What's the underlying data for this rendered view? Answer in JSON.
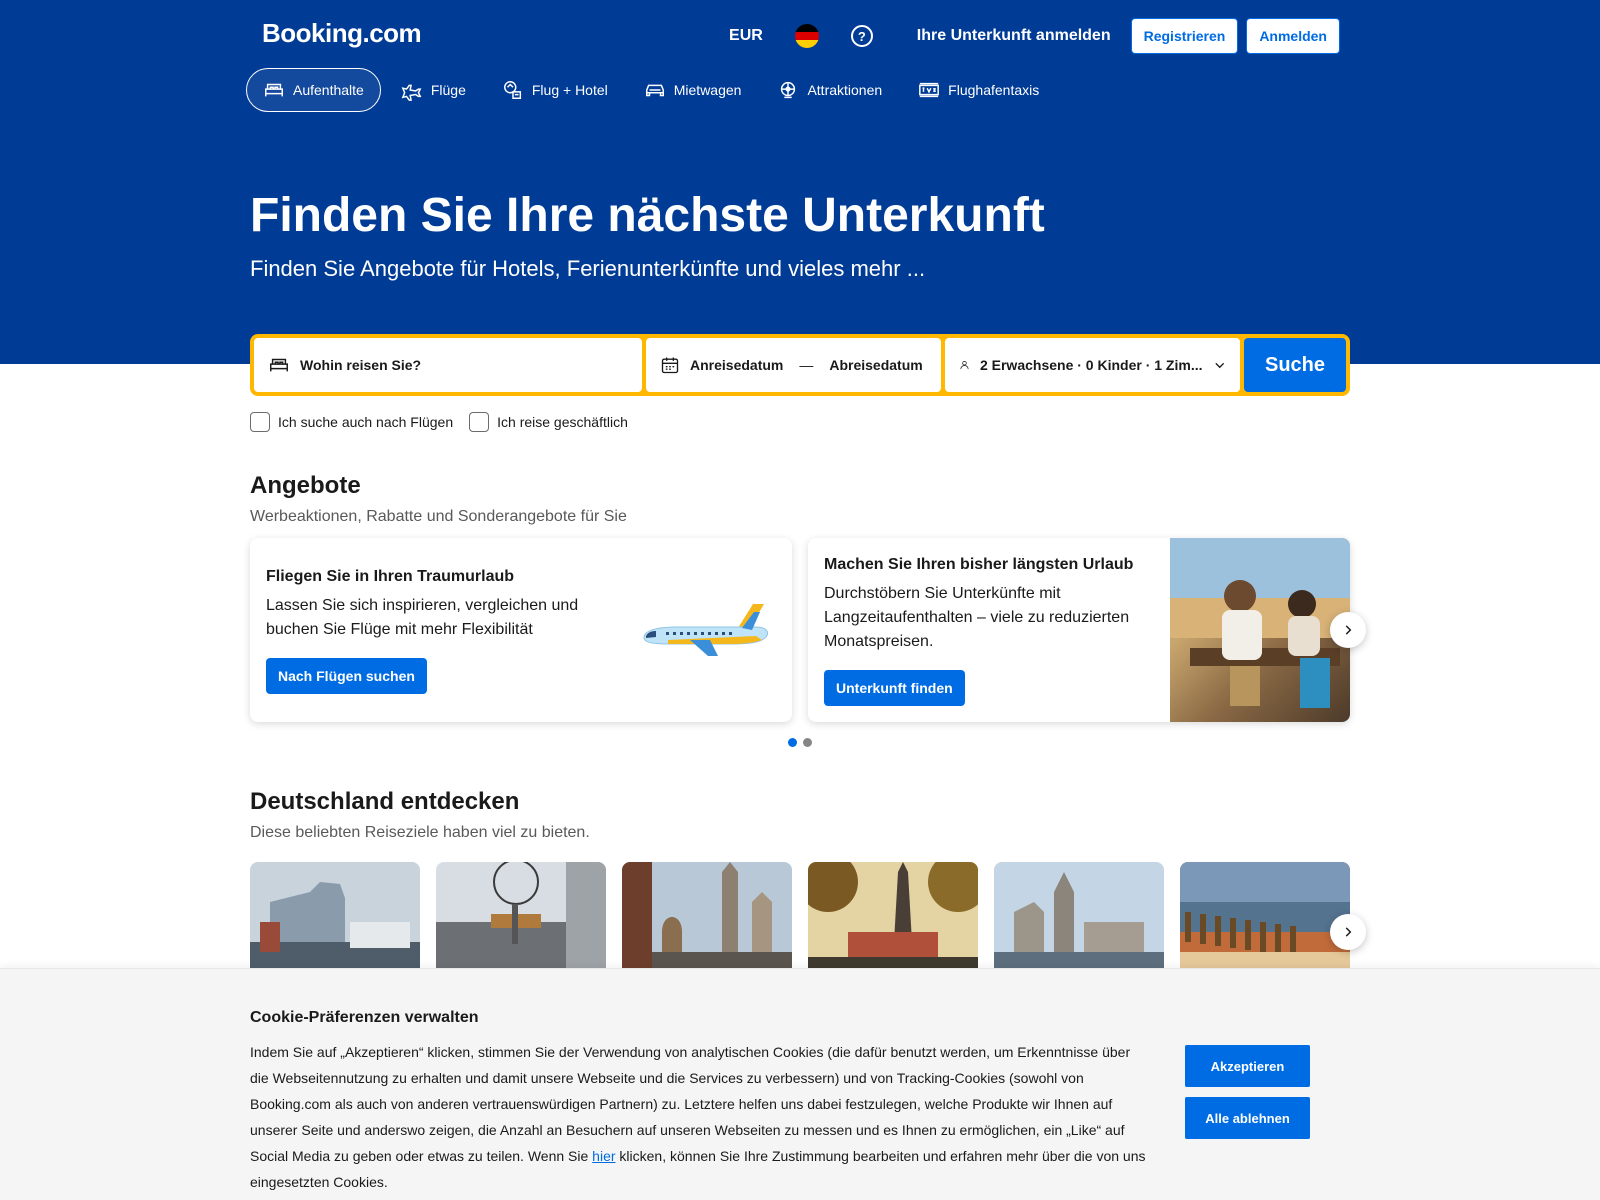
{
  "header": {
    "logo": "Booking.com",
    "currency": "EUR",
    "list_property": "Ihre Unterkunft anmelden",
    "register": "Registrieren",
    "sign_in": "Anmelden",
    "help": "?"
  },
  "nav": {
    "items": [
      {
        "label": "Aufenthalte",
        "icon": "bed-icon",
        "active": true
      },
      {
        "label": "Flüge",
        "icon": "plane-icon"
      },
      {
        "label": "Flug + Hotel",
        "icon": "flight-hotel-icon"
      },
      {
        "label": "Mietwagen",
        "icon": "car-icon"
      },
      {
        "label": "Attraktionen",
        "icon": "attractions-icon"
      },
      {
        "label": "Flughafentaxis",
        "icon": "taxi-icon"
      }
    ]
  },
  "hero": {
    "title": "Finden Sie Ihre nächste Unterkunft",
    "subtitle": "Finden Sie Angebote für Hotels, Ferienunterkünfte und vieles mehr ..."
  },
  "search": {
    "destination": "Wohin reisen Sie?",
    "checkin": "Anreisedatum",
    "dash": "—",
    "checkout": "Abreisedatum",
    "guests": "2 Erwachsene · 0 Kinder · 1 Zim...",
    "button": "Suche"
  },
  "checkboxes": {
    "flights": "Ich suche auch nach Flügen",
    "business": "Ich reise geschäftlich"
  },
  "offers": {
    "title": "Angebote",
    "subtitle": "Werbeaktionen, Rabatte und Sonderangebote für Sie",
    "cards": [
      {
        "title": "Fliegen Sie in Ihren Traumurlaub",
        "text": "Lassen Sie sich inspirieren, vergleichen und buchen Sie Flüge mit mehr Flexibilität",
        "button": "Nach Flügen suchen"
      },
      {
        "title": "Machen Sie Ihren bisher längsten Urlaub",
        "text": "Durchstöbern Sie Unterkünfte mit Langzeitaufenthalten – viele zu reduzierten Monatspreisen.",
        "button": "Unterkunft finden"
      }
    ]
  },
  "explore": {
    "title": "Deutschland entdecken",
    "subtitle": "Diese beliebten Reiseziele haben viel zu bieten."
  },
  "cookie": {
    "title": "Cookie-Präferenzen verwalten",
    "text_before": "Indem Sie auf „Akzeptieren“ klicken, stimmen Sie der Verwendung von analytischen Cookies (die dafür benutzt werden, um Erkenntnisse über die Webseitennutzung zu erhalten und damit unsere Webseite und die Services zu verbessern) und von Tracking-Cookies (sowohl von Booking.com als auch von anderen vertrauenswürdigen Partnern) zu. Letztere helfen uns dabei festzulegen, welche Produkte wir Ihnen auf unserer Seite und anderswo zeigen, die Anzahl an Besuchern auf unseren Webseiten zu messen und es Ihnen zu ermöglichen, ein „Like“ auf Social Media zu geben oder etwas zu teilen. Wenn Sie ",
    "link": "hier",
    "text_after": " klicken, können Sie Ihre Zustimmung bearbeiten und erfahren mehr über die von uns eingesetzten Cookies.",
    "accept": "Akzeptieren",
    "reject": "Alle ablehnen"
  },
  "colors": {
    "brand": "#003b95",
    "accent": "#006ce4",
    "search_border": "#ffb700"
  }
}
